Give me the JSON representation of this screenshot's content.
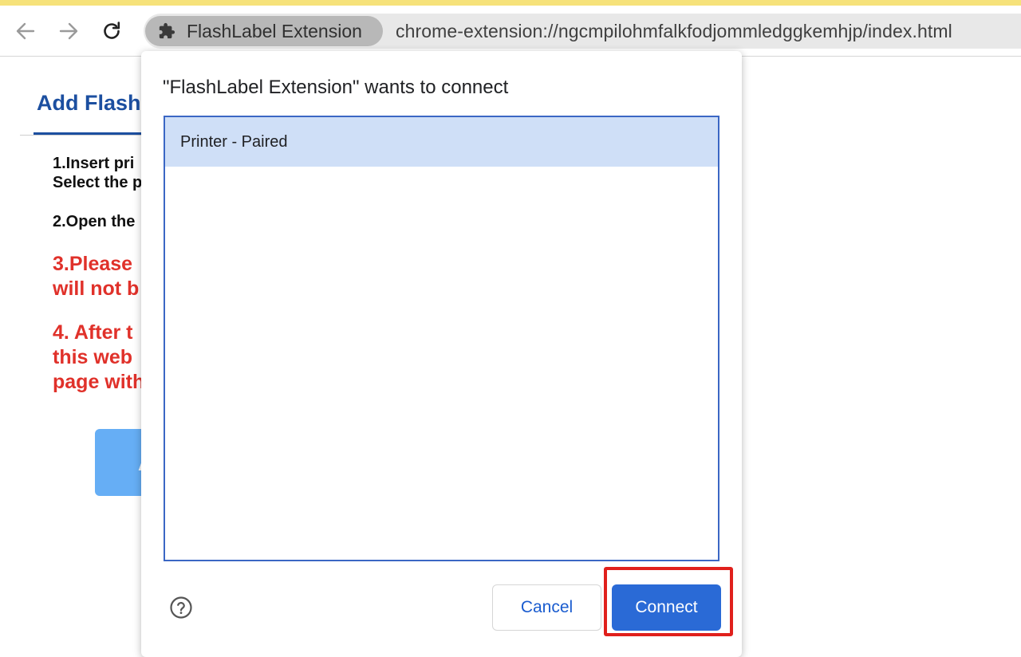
{
  "browser": {
    "extension_chip_label": "FlashLabel Extension",
    "url": "chrome-extension://ngcmpilohmfalkfodjommledggkemhjp/index.html",
    "icons": {
      "back": "arrow-left-icon",
      "forward": "arrow-right-icon",
      "reload": "reload-icon",
      "extension": "puzzle-piece-icon"
    }
  },
  "background_page": {
    "heading": "Add Flash",
    "steps": [
      {
        "lines": [
          "1.Insert pri",
          "Select the p"
        ]
      },
      {
        "lines": [
          "2.Open the"
        ]
      },
      {
        "lines": [
          "3.Please",
          "will not b"
        ]
      },
      {
        "lines": [
          "4. After t",
          "this web",
          "page with"
        ]
      }
    ],
    "button_label": "A"
  },
  "dialog": {
    "title": "\"FlashLabel Extension\" wants to connect",
    "devices": [
      {
        "label": "Printer - Paired",
        "selected": true
      }
    ],
    "cancel_label": "Cancel",
    "connect_label": "Connect",
    "help_icon": "help-circle-icon"
  },
  "colors": {
    "accent": "#2a6ad6",
    "selection": "#cfdff7",
    "heading_blue": "#1c4fa0",
    "warning_red": "#e0312a",
    "annotation_red": "#e0201c"
  }
}
